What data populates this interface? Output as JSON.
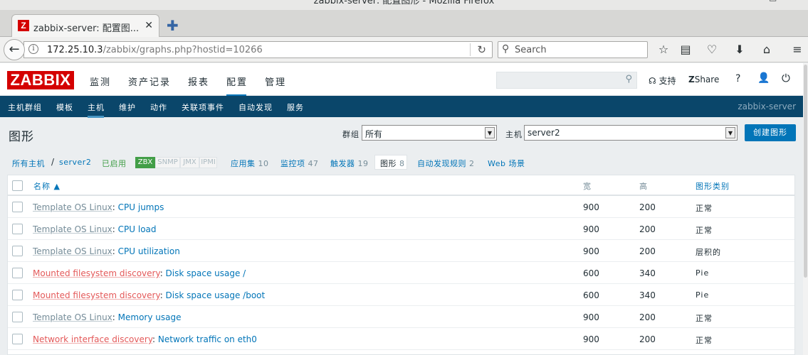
{
  "window": {
    "title": "zabbix-server: 配置图形 - Mozilla Firefox"
  },
  "browser": {
    "tab_title": "zabbix-server: 配置图...",
    "favicon_letter": "Z",
    "url_host": "172.25.10.3",
    "url_path": "/zabbix/graphs.php?hostid=10266",
    "search_placeholder": "Search"
  },
  "header": {
    "logo": "ZABBIX",
    "menu": [
      "监测",
      "资产记录",
      "报表",
      "配置",
      "管理"
    ],
    "active_menu": "配置",
    "support_label": "支持",
    "share_label": "Share",
    "help_label": "?"
  },
  "submenu": {
    "items": [
      "主机群组",
      "模板",
      "主机",
      "维护",
      "动作",
      "关联项事件",
      "自动发现",
      "服务"
    ],
    "active": "主机",
    "server_name": "zabbix-server"
  },
  "page": {
    "title": "图形",
    "group_label": "群组",
    "group_value": "所有",
    "host_label": "主机",
    "host_value": "server2",
    "create_button": "创建图形"
  },
  "breadcrumb": {
    "all_hosts": "所有主机",
    "separator": "/",
    "host": "server2",
    "status": "已启用",
    "badges": [
      "ZBX",
      "SNMP",
      "JMX",
      "IPMI"
    ],
    "links": [
      {
        "label": "应用集",
        "count": "10"
      },
      {
        "label": "监控项",
        "count": "47"
      },
      {
        "label": "触发器",
        "count": "19"
      },
      {
        "label": "图形",
        "count": "8"
      },
      {
        "label": "自动发现规则",
        "count": "2"
      },
      {
        "label": "Web 场景",
        "count": ""
      }
    ]
  },
  "table": {
    "columns": {
      "name": "名称 ▲",
      "width": "宽",
      "height": "高",
      "type": "图形类别"
    },
    "rows": [
      {
        "prefix": "Template OS Linux",
        "prefix_kind": "template",
        "name": "CPU jumps",
        "width": "900",
        "height": "200",
        "type": "正常"
      },
      {
        "prefix": "Template OS Linux",
        "prefix_kind": "template",
        "name": "CPU load",
        "width": "900",
        "height": "200",
        "type": "正常"
      },
      {
        "prefix": "Template OS Linux",
        "prefix_kind": "template",
        "name": "CPU utilization",
        "width": "900",
        "height": "200",
        "type": "层积的"
      },
      {
        "prefix": "Mounted filesystem discovery",
        "prefix_kind": "discovery",
        "name": "Disk space usage /",
        "width": "600",
        "height": "340",
        "type": "Pie"
      },
      {
        "prefix": "Mounted filesystem discovery",
        "prefix_kind": "discovery",
        "name": "Disk space usage /boot",
        "width": "600",
        "height": "340",
        "type": "Pie"
      },
      {
        "prefix": "Template OS Linux",
        "prefix_kind": "template",
        "name": "Memory usage",
        "width": "900",
        "height": "200",
        "type": "正常"
      },
      {
        "prefix": "Network interface discovery",
        "prefix_kind": "discovery",
        "name": "Network traffic on eth0",
        "width": "900",
        "height": "200",
        "type": "正常"
      }
    ]
  }
}
